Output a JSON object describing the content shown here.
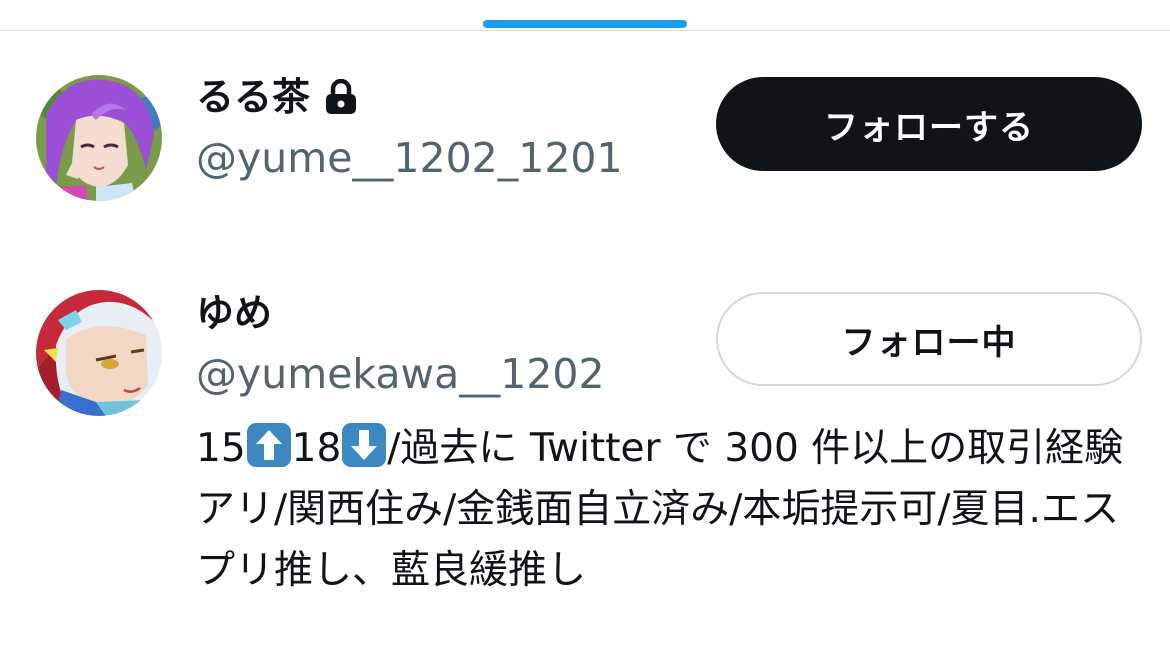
{
  "users": [
    {
      "display_name": "るる茶",
      "handle": "@yume__1202_1201",
      "protected": true,
      "button_label": "フォローする",
      "button_state": "not_following"
    },
    {
      "display_name": "ゆめ",
      "handle": "@yumekawa__1202",
      "protected": false,
      "button_label": "フォロー中",
      "button_state": "following",
      "bio": {
        "part1": "15",
        "emoji_up": "⬆️",
        "part2": "18",
        "emoji_down": "⬇️",
        "part3": "/過去に Twitter で 300 件以上の取引経験アリ/関西住み/金銭面自立済み/本垢提示可/夏目.エスプリ推し、藍良緩推し"
      }
    }
  ],
  "icons": {
    "lock": "lock-icon",
    "up_arrow": "up-arrow-emoji-icon",
    "down_arrow": "down-arrow-emoji-icon"
  },
  "colors": {
    "accent": "#1d9bf0",
    "follow_button_bg": "#0f1419",
    "handle_text": "#536471",
    "following_border": "#cfd9de",
    "emoji_box": "#3b88c3"
  }
}
